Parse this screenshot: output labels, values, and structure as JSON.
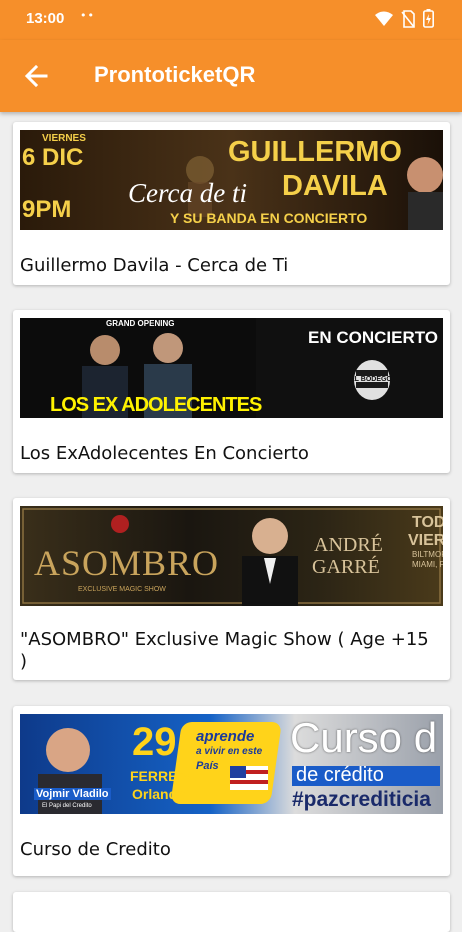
{
  "status_bar": {
    "time": "13:00",
    "dots": "••"
  },
  "app_bar": {
    "title": "ProntoticketQR"
  },
  "events": [
    {
      "title": "Guillermo Davila - Cerca de Ti",
      "banner": {
        "day_name": "VIERNES",
        "day_num": "6",
        "month": "DIC",
        "time": "9PM",
        "headline1": "GUILLERMO",
        "headline2": "DAVILA",
        "script": "Cerca de ti",
        "subline": "Y SU BANDA EN CONCIERTO"
      }
    },
    {
      "title": "Los ExAdolecentes En Concierto",
      "banner": {
        "top": "GRAND OPENING",
        "band": "LOS EX ADOLECENTES",
        "right": "EN CONCIERTO",
        "logo": "EL BODEGON"
      }
    },
    {
      "title": "\"ASOMBRO\" Exclusive Magic Show  ( Age +15 )",
      "banner": {
        "word": "ASOMBRO",
        "sub": "EXCLUSIVE MAGIC SHOW",
        "name1": "ANDRÉ",
        "name2": "GARRÉ",
        "right1": "TODOS",
        "right2": "VIERN",
        "right3": "BILTMORE",
        "right4": "MIAMI, F"
      }
    },
    {
      "title": "Curso de Credito",
      "banner": {
        "day": "29",
        "month": "FERRERO",
        "city": "Orlando",
        "promo1": "aprende",
        "promo2": "a vivir en este",
        "promo3": "País",
        "curso": "Curso d",
        "credito": "de crédito",
        "hashtag": "#pazcrediticia",
        "person": "Vojmir Vladilo",
        "person_sub": "El Papi del Credito"
      }
    }
  ]
}
